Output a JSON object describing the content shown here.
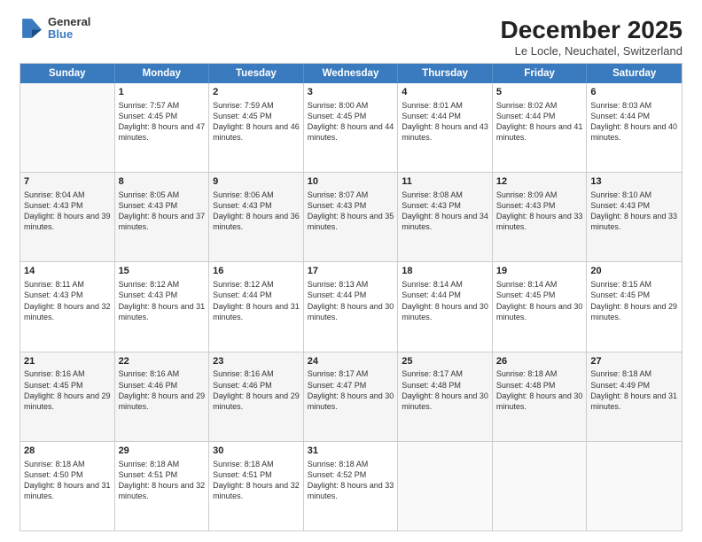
{
  "logo": {
    "line1": "General",
    "line2": "Blue"
  },
  "title": "December 2025",
  "subtitle": "Le Locle, Neuchatel, Switzerland",
  "days_of_week": [
    "Sunday",
    "Monday",
    "Tuesday",
    "Wednesday",
    "Thursday",
    "Friday",
    "Saturday"
  ],
  "weeks": [
    [
      {
        "day": "",
        "sunrise": "",
        "sunset": "",
        "daylight": ""
      },
      {
        "day": "1",
        "sunrise": "Sunrise: 7:57 AM",
        "sunset": "Sunset: 4:45 PM",
        "daylight": "Daylight: 8 hours and 47 minutes."
      },
      {
        "day": "2",
        "sunrise": "Sunrise: 7:59 AM",
        "sunset": "Sunset: 4:45 PM",
        "daylight": "Daylight: 8 hours and 46 minutes."
      },
      {
        "day": "3",
        "sunrise": "Sunrise: 8:00 AM",
        "sunset": "Sunset: 4:45 PM",
        "daylight": "Daylight: 8 hours and 44 minutes."
      },
      {
        "day": "4",
        "sunrise": "Sunrise: 8:01 AM",
        "sunset": "Sunset: 4:44 PM",
        "daylight": "Daylight: 8 hours and 43 minutes."
      },
      {
        "day": "5",
        "sunrise": "Sunrise: 8:02 AM",
        "sunset": "Sunset: 4:44 PM",
        "daylight": "Daylight: 8 hours and 41 minutes."
      },
      {
        "day": "6",
        "sunrise": "Sunrise: 8:03 AM",
        "sunset": "Sunset: 4:44 PM",
        "daylight": "Daylight: 8 hours and 40 minutes."
      }
    ],
    [
      {
        "day": "7",
        "sunrise": "Sunrise: 8:04 AM",
        "sunset": "Sunset: 4:43 PM",
        "daylight": "Daylight: 8 hours and 39 minutes."
      },
      {
        "day": "8",
        "sunrise": "Sunrise: 8:05 AM",
        "sunset": "Sunset: 4:43 PM",
        "daylight": "Daylight: 8 hours and 37 minutes."
      },
      {
        "day": "9",
        "sunrise": "Sunrise: 8:06 AM",
        "sunset": "Sunset: 4:43 PM",
        "daylight": "Daylight: 8 hours and 36 minutes."
      },
      {
        "day": "10",
        "sunrise": "Sunrise: 8:07 AM",
        "sunset": "Sunset: 4:43 PM",
        "daylight": "Daylight: 8 hours and 35 minutes."
      },
      {
        "day": "11",
        "sunrise": "Sunrise: 8:08 AM",
        "sunset": "Sunset: 4:43 PM",
        "daylight": "Daylight: 8 hours and 34 minutes."
      },
      {
        "day": "12",
        "sunrise": "Sunrise: 8:09 AM",
        "sunset": "Sunset: 4:43 PM",
        "daylight": "Daylight: 8 hours and 33 minutes."
      },
      {
        "day": "13",
        "sunrise": "Sunrise: 8:10 AM",
        "sunset": "Sunset: 4:43 PM",
        "daylight": "Daylight: 8 hours and 33 minutes."
      }
    ],
    [
      {
        "day": "14",
        "sunrise": "Sunrise: 8:11 AM",
        "sunset": "Sunset: 4:43 PM",
        "daylight": "Daylight: 8 hours and 32 minutes."
      },
      {
        "day": "15",
        "sunrise": "Sunrise: 8:12 AM",
        "sunset": "Sunset: 4:43 PM",
        "daylight": "Daylight: 8 hours and 31 minutes."
      },
      {
        "day": "16",
        "sunrise": "Sunrise: 8:12 AM",
        "sunset": "Sunset: 4:44 PM",
        "daylight": "Daylight: 8 hours and 31 minutes."
      },
      {
        "day": "17",
        "sunrise": "Sunrise: 8:13 AM",
        "sunset": "Sunset: 4:44 PM",
        "daylight": "Daylight: 8 hours and 30 minutes."
      },
      {
        "day": "18",
        "sunrise": "Sunrise: 8:14 AM",
        "sunset": "Sunset: 4:44 PM",
        "daylight": "Daylight: 8 hours and 30 minutes."
      },
      {
        "day": "19",
        "sunrise": "Sunrise: 8:14 AM",
        "sunset": "Sunset: 4:45 PM",
        "daylight": "Daylight: 8 hours and 30 minutes."
      },
      {
        "day": "20",
        "sunrise": "Sunrise: 8:15 AM",
        "sunset": "Sunset: 4:45 PM",
        "daylight": "Daylight: 8 hours and 29 minutes."
      }
    ],
    [
      {
        "day": "21",
        "sunrise": "Sunrise: 8:16 AM",
        "sunset": "Sunset: 4:45 PM",
        "daylight": "Daylight: 8 hours and 29 minutes."
      },
      {
        "day": "22",
        "sunrise": "Sunrise: 8:16 AM",
        "sunset": "Sunset: 4:46 PM",
        "daylight": "Daylight: 8 hours and 29 minutes."
      },
      {
        "day": "23",
        "sunrise": "Sunrise: 8:16 AM",
        "sunset": "Sunset: 4:46 PM",
        "daylight": "Daylight: 8 hours and 29 minutes."
      },
      {
        "day": "24",
        "sunrise": "Sunrise: 8:17 AM",
        "sunset": "Sunset: 4:47 PM",
        "daylight": "Daylight: 8 hours and 30 minutes."
      },
      {
        "day": "25",
        "sunrise": "Sunrise: 8:17 AM",
        "sunset": "Sunset: 4:48 PM",
        "daylight": "Daylight: 8 hours and 30 minutes."
      },
      {
        "day": "26",
        "sunrise": "Sunrise: 8:18 AM",
        "sunset": "Sunset: 4:48 PM",
        "daylight": "Daylight: 8 hours and 30 minutes."
      },
      {
        "day": "27",
        "sunrise": "Sunrise: 8:18 AM",
        "sunset": "Sunset: 4:49 PM",
        "daylight": "Daylight: 8 hours and 31 minutes."
      }
    ],
    [
      {
        "day": "28",
        "sunrise": "Sunrise: 8:18 AM",
        "sunset": "Sunset: 4:50 PM",
        "daylight": "Daylight: 8 hours and 31 minutes."
      },
      {
        "day": "29",
        "sunrise": "Sunrise: 8:18 AM",
        "sunset": "Sunset: 4:51 PM",
        "daylight": "Daylight: 8 hours and 32 minutes."
      },
      {
        "day": "30",
        "sunrise": "Sunrise: 8:18 AM",
        "sunset": "Sunset: 4:51 PM",
        "daylight": "Daylight: 8 hours and 32 minutes."
      },
      {
        "day": "31",
        "sunrise": "Sunrise: 8:18 AM",
        "sunset": "Sunset: 4:52 PM",
        "daylight": "Daylight: 8 hours and 33 minutes."
      },
      {
        "day": "",
        "sunrise": "",
        "sunset": "",
        "daylight": ""
      },
      {
        "day": "",
        "sunrise": "",
        "sunset": "",
        "daylight": ""
      },
      {
        "day": "",
        "sunrise": "",
        "sunset": "",
        "daylight": ""
      }
    ]
  ]
}
